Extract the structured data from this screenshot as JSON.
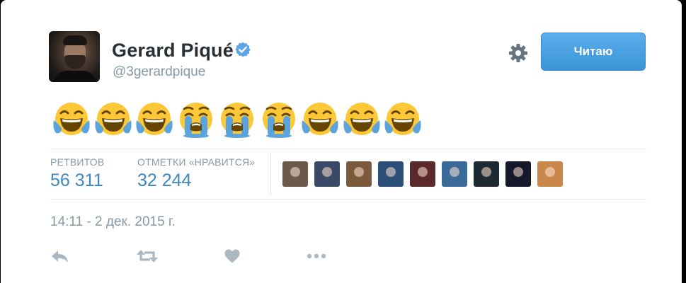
{
  "tweet": {
    "author": {
      "name": "Gerard Piqué",
      "handle": "@3gerardpique"
    },
    "follow_label": "Читаю",
    "emojis": [
      "laugh-cry",
      "laugh-cry",
      "laugh-cry",
      "loud-cry",
      "loud-cry",
      "loud-cry",
      "laugh-cry",
      "laugh-cry",
      "laugh-cry"
    ],
    "stats": {
      "retweets_label": "РЕТВИТОВ",
      "retweets_value": "56 311",
      "likes_label": "ОТМЕТКИ «НРАВИТСЯ»",
      "likes_value": "32 244"
    },
    "likers": [
      {
        "color": "#6b5a4a"
      },
      {
        "color": "#3a4a66"
      },
      {
        "color": "#7a5a3a"
      },
      {
        "color": "#2c4f7a"
      },
      {
        "color": "#5a2a2a"
      },
      {
        "color": "#3a6a9a"
      },
      {
        "color": "#1e2a33"
      },
      {
        "color": "#14182a"
      },
      {
        "color": "#c9884a"
      }
    ],
    "timestamp": "14:11 - 2 дек. 2015 г.",
    "actions": [
      "reply-icon",
      "retweet-icon",
      "like-icon",
      "more-icon"
    ]
  },
  "colors": {
    "accent": "#3b88c3",
    "muted": "#8899a6",
    "icon": "#aab8c2",
    "follow_button": "#4ba2e4",
    "emoji_face": "#fdc838",
    "tear": "#5ba3dc"
  }
}
